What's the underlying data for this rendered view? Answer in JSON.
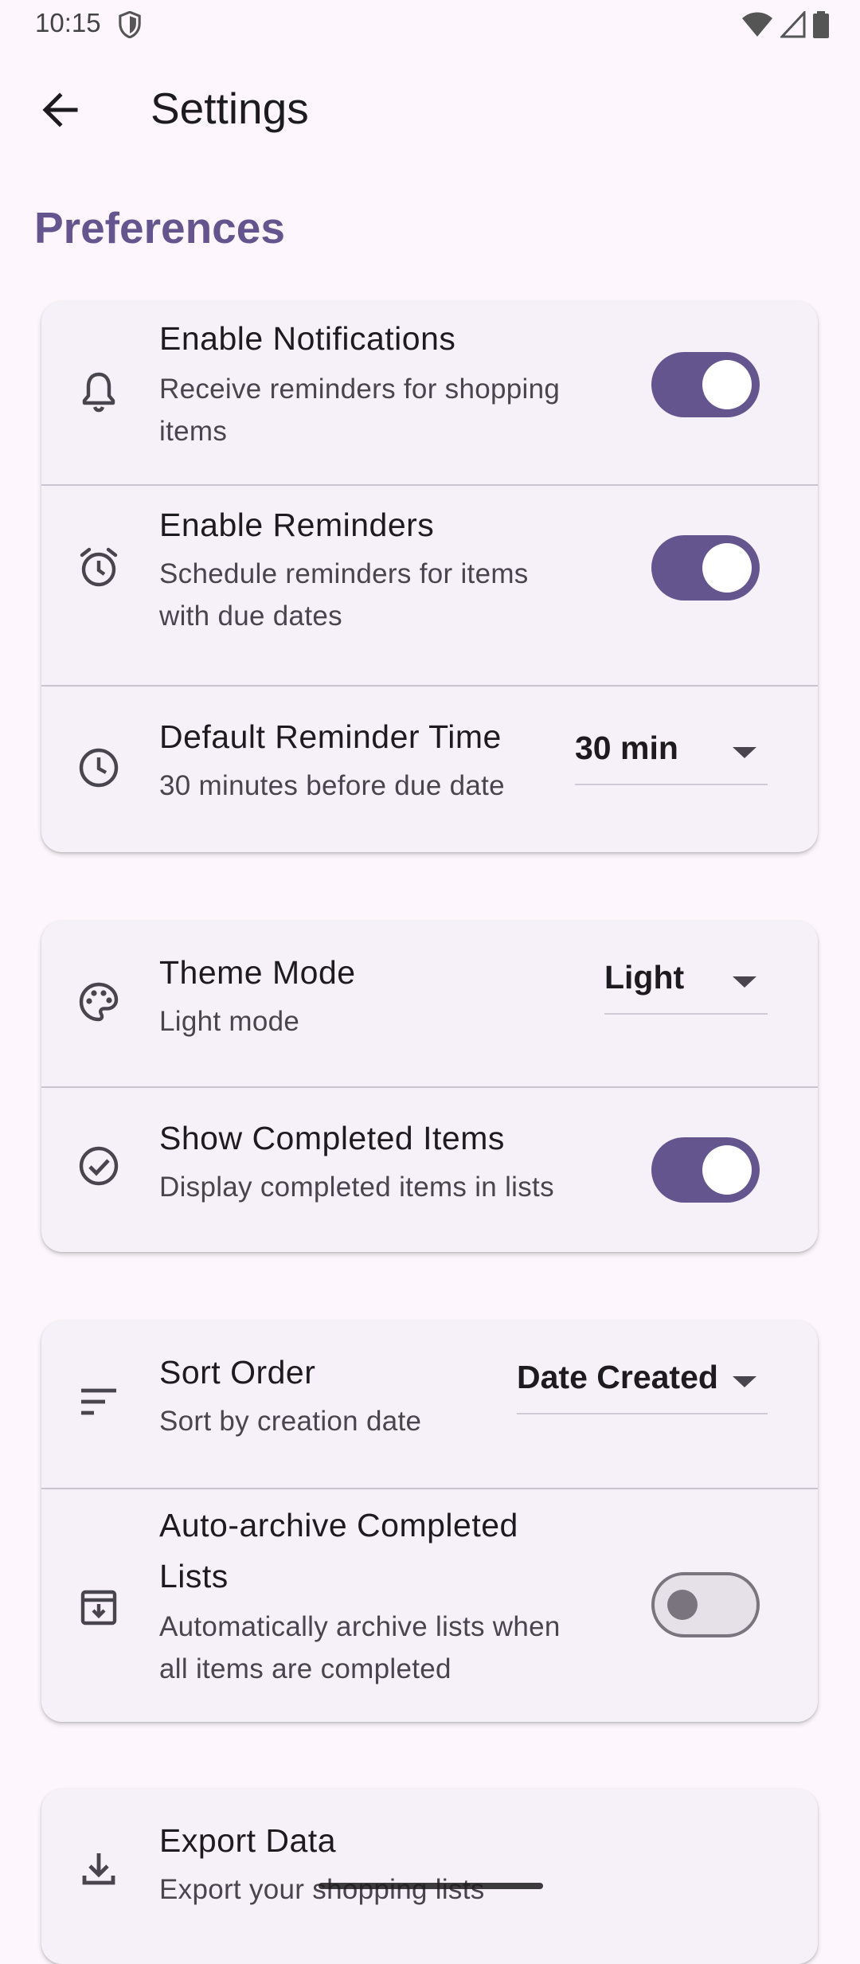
{
  "status_bar": {
    "time": "10:15"
  },
  "app_bar": {
    "title": "Settings"
  },
  "section": {
    "title": "Preferences"
  },
  "settings": {
    "notifications": {
      "title": "Enable Notifications",
      "subtitle_line1": "Receive reminders for shopping",
      "subtitle_line2": "items",
      "enabled": true,
      "icon": "bell-icon"
    },
    "reminders": {
      "title": "Enable Reminders",
      "subtitle_line1": "Schedule reminders for items",
      "subtitle_line2": "with due dates",
      "enabled": true,
      "icon": "alarm-icon"
    },
    "reminder_time": {
      "title": "Default Reminder Time",
      "subtitle": "30 minutes before due date",
      "value": "30 min",
      "icon": "clock-icon"
    },
    "theme_mode": {
      "title": "Theme Mode",
      "subtitle": "Light mode",
      "value": "Light",
      "icon": "palette-icon"
    },
    "show_completed": {
      "title": "Show Completed Items",
      "subtitle": "Display completed items in lists",
      "enabled": true,
      "icon": "check-circle-icon"
    },
    "sort_order": {
      "title": "Sort Order",
      "subtitle": "Sort by creation date",
      "value": "Date Created",
      "icon": "sort-icon"
    },
    "auto_archive": {
      "title_line1": "Auto-archive Completed",
      "title_line2": "Lists",
      "subtitle_line1": "Automatically archive lists when",
      "subtitle_line2": "all items are completed",
      "enabled": false,
      "icon": "archive-icon"
    },
    "export": {
      "title": "Export Data",
      "subtitle": "Export your shopping lists",
      "icon": "download-icon"
    }
  },
  "colors": {
    "accent": "#65558f",
    "background": "#fdf7fd",
    "card": "#f6f1f8"
  }
}
